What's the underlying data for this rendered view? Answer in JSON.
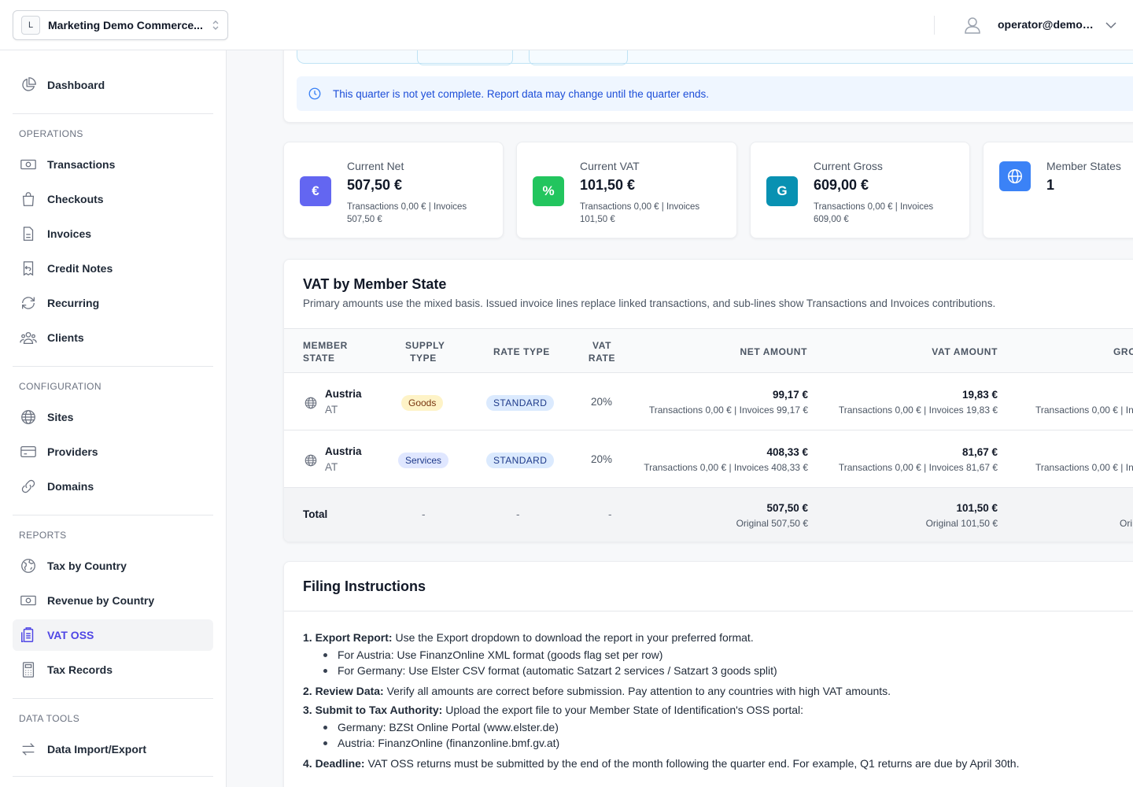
{
  "topbar": {
    "site_badge": "L",
    "site_name": "Marketing Demo Commerce...",
    "user_email": "operator@demo...."
  },
  "sidebar": {
    "dashboard": "Dashboard",
    "sections": {
      "operations": "OPERATIONS",
      "configuration": "CONFIGURATION",
      "reports": "REPORTS",
      "data_tools": "DATA TOOLS"
    },
    "items": {
      "transactions": "Transactions",
      "checkouts": "Checkouts",
      "invoices": "Invoices",
      "credit_notes": "Credit Notes",
      "recurring": "Recurring",
      "clients": "Clients",
      "sites": "Sites",
      "providers": "Providers",
      "domains": "Domains",
      "tax_by_country": "Tax by Country",
      "revenue_by_country": "Revenue by Country",
      "vat_oss": "VAT OSS",
      "tax_records": "Tax Records",
      "data_import_export": "Data Import/Export"
    }
  },
  "notice": "This quarter is not yet complete. Report data may change until the quarter ends.",
  "stats": {
    "net": {
      "icon": "€",
      "label": "Current Net",
      "value": "507,50 €",
      "sub": "Transactions 0,00 € | Invoices 507,50 €"
    },
    "vat": {
      "icon": "%",
      "label": "Current VAT",
      "value": "101,50 €",
      "sub": "Transactions 0,00 € | Invoices 101,50 €"
    },
    "gross": {
      "icon": "G",
      "label": "Current Gross",
      "value": "609,00 €",
      "sub": "Transactions 0,00 € | Invoices 609,00 €"
    },
    "members": {
      "label": "Member States",
      "value": "1"
    }
  },
  "vat_table": {
    "title": "VAT by Member State",
    "subtitle": "Primary amounts use the mixed basis. Issued invoice lines replace linked transactions, and sub-lines show Transactions and Invoices contributions.",
    "headers": {
      "member_state_1": "MEMBER",
      "member_state_2": "STATE",
      "supply_1": "SUPPLY",
      "supply_2": "TYPE",
      "rate_type": "RATE TYPE",
      "vat_rate_1": "VAT",
      "vat_rate_2": "RATE",
      "net": "NET AMOUNT",
      "vat": "VAT AMOUNT",
      "gross": "GRO"
    },
    "rows": [
      {
        "country": "Austria",
        "code": "AT",
        "supply": "Goods",
        "rate_type": "STANDARD",
        "rate": "20%",
        "net": "99,17 €",
        "net_sub": "Transactions 0,00 € | Invoices 99,17 €",
        "vat": "19,83 €",
        "vat_sub": "Transactions 0,00 € | Invoices 19,83 €",
        "gross_sub": "Transactions 0,00 € | Inv"
      },
      {
        "country": "Austria",
        "code": "AT",
        "supply": "Services",
        "rate_type": "STANDARD",
        "rate": "20%",
        "net": "408,33 €",
        "net_sub": "Transactions 0,00 € | Invoices 408,33 €",
        "vat": "81,67 €",
        "vat_sub": "Transactions 0,00 € | Invoices 81,67 €",
        "gross_sub": "Transactions 0,00 € | Inv"
      }
    ],
    "total": {
      "label": "Total",
      "dash": "-",
      "net": "507,50 €",
      "net_sub": "Original 507,50 €",
      "vat": "101,50 €",
      "vat_sub": "Original 101,50 €",
      "gross_sub": "Ori"
    }
  },
  "filing": {
    "title": "Filing Instructions",
    "step1_label": "1. Export Report:",
    "step1_text": " Use the Export dropdown to download the report in your preferred format.",
    "step1_bullets": [
      "For Austria: Use FinanzOnline XML format (goods flag set per row)",
      "For Germany: Use Elster CSV format (automatic Satzart 2 services / Satzart 3 goods split)"
    ],
    "step2_label": "2. Review Data:",
    "step2_text": " Verify all amounts are correct before submission. Pay attention to any countries with high VAT amounts.",
    "step3_label": "3. Submit to Tax Authority:",
    "step3_text": " Upload the export file to your Member State of Identification's OSS portal:",
    "step3_bullets": [
      "Germany: BZSt Online Portal (www.elster.de)",
      "Austria: FinanzOnline (finanzonline.bmf.gv.at)"
    ],
    "step4_label": "4. Deadline:",
    "step4_text": " VAT OSS returns must be submitted by the end of the month following the quarter end. For example, Q1 returns are due by April 30th."
  },
  "colors": {
    "accent": "#4f46e5",
    "net_icon": "#6366f1",
    "vat_icon": "#22c55e",
    "gross_icon": "#0891b2",
    "members_icon": "#3b82f6"
  }
}
